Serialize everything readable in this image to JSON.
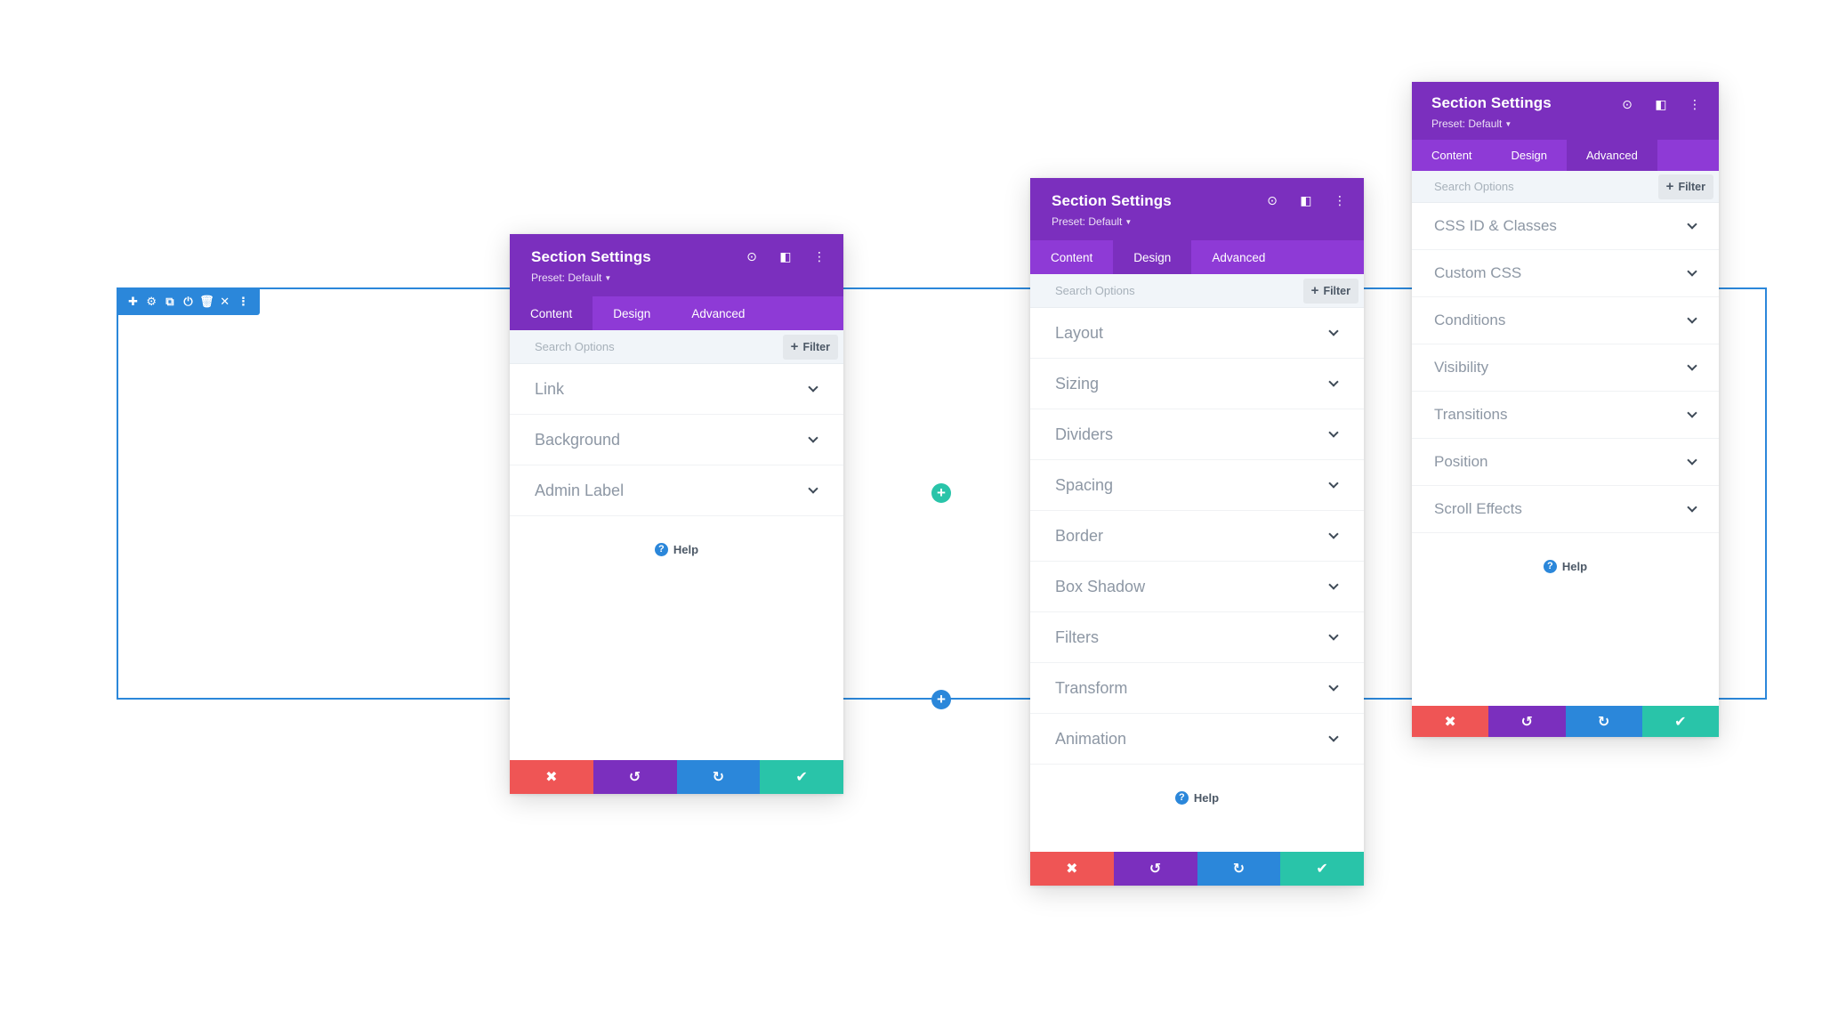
{
  "section_toolbar": {
    "icons": [
      "move-icon",
      "gear-icon",
      "duplicate-icon",
      "power-icon",
      "trash-icon",
      "close-icon",
      "more-icon"
    ],
    "glyphs": [
      "✚",
      "⚙",
      "⧉",
      "⏻",
      "🗑",
      "✕",
      "⋮"
    ]
  },
  "add_row_glyph": "+",
  "add_section_glyph": "+",
  "colors": {
    "purple": "#7b2fbe",
    "purple_light": "#8e3ad6",
    "blue": "#2b87da",
    "teal": "#29c4a9",
    "red": "#ef5555"
  },
  "modals": [
    {
      "title": "Section Settings",
      "preset": "Preset: Default",
      "tabs": [
        "Content",
        "Design",
        "Advanced"
      ],
      "active_tab": "Content",
      "search_placeholder": "Search Options",
      "filter_label": "Filter",
      "items": [
        "Link",
        "Background",
        "Admin Label"
      ],
      "help": "Help"
    },
    {
      "title": "Section Settings",
      "preset": "Preset: Default",
      "tabs": [
        "Content",
        "Design",
        "Advanced"
      ],
      "active_tab": "Design",
      "search_placeholder": "Search Options",
      "filter_label": "Filter",
      "items": [
        "Layout",
        "Sizing",
        "Dividers",
        "Spacing",
        "Border",
        "Box Shadow",
        "Filters",
        "Transform",
        "Animation"
      ],
      "help": "Help"
    },
    {
      "title": "Section Settings",
      "preset": "Preset: Default",
      "tabs": [
        "Content",
        "Design",
        "Advanced"
      ],
      "active_tab": "Advanced",
      "search_placeholder": "Search Options",
      "filter_label": "Filter",
      "items": [
        "CSS ID & Classes",
        "Custom CSS",
        "Conditions",
        "Visibility",
        "Transitions",
        "Position",
        "Scroll Effects"
      ],
      "help": "Help"
    }
  ],
  "header_icons": {
    "names": [
      "target-icon",
      "split-view-icon",
      "more-options-icon"
    ],
    "glyphs": [
      "⊙",
      "◧",
      "⋮"
    ]
  },
  "footer": {
    "names": [
      "cancel-button",
      "undo-button",
      "redo-button",
      "save-button"
    ],
    "glyphs": [
      "✖",
      "↺",
      "↻",
      "✔"
    ]
  }
}
